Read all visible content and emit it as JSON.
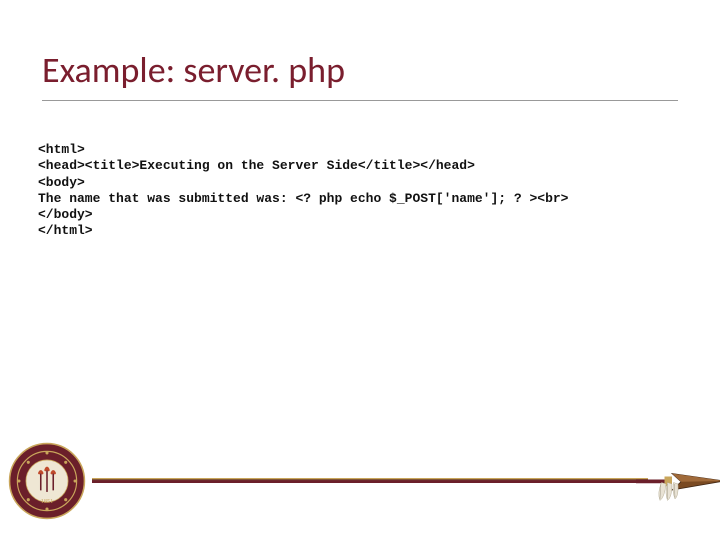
{
  "title": "Example: server. php",
  "code_lines": [
    "<html>",
    "<head><title>Executing on the Server Side</title></head>",
    "<body>",
    "The name that was submitted was: <? php echo $_POST['name']; ? ><br>",
    "</body>",
    "</html>"
  ],
  "theme": {
    "accent": "#7a1e2e",
    "seal_year": "1851"
  }
}
